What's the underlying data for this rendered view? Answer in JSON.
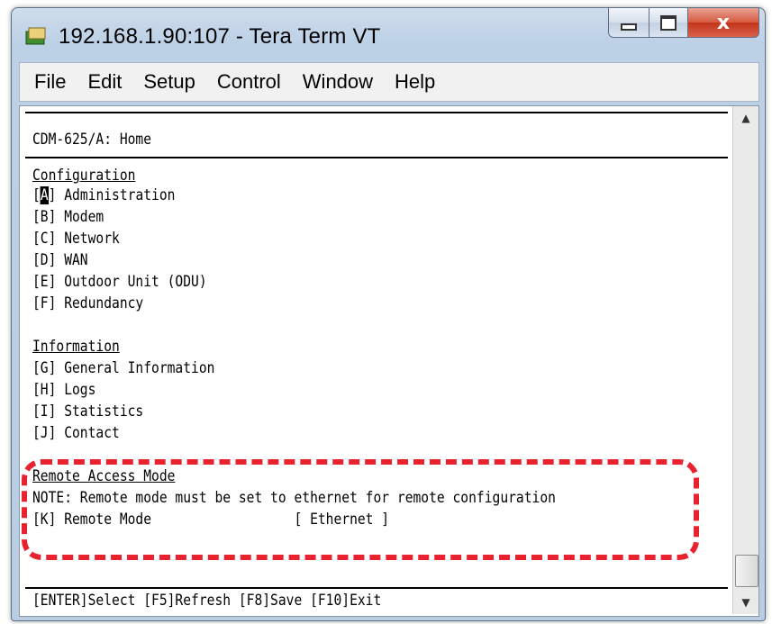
{
  "window": {
    "title": "192.168.1.90:107 - Tera Term VT",
    "icon": "tera-term-icon",
    "close_glyph": "x"
  },
  "menu": [
    "File",
    "Edit",
    "Setup",
    "Control",
    "Window",
    "Help"
  ],
  "terminal": {
    "header": "CDM-625/A: Home",
    "config_heading": "Configuration",
    "admin_key_open": "[",
    "admin_key_cursor": "A",
    "admin_key_rest": "] Administration",
    "config_items": [
      "[B] Modem",
      "[C] Network",
      "[D] WAN",
      "[E] Outdoor Unit (ODU)",
      "[F] Redundancy"
    ],
    "info_heading": "Information",
    "info_items": [
      "[G] General Information",
      "[H] Logs",
      "[I] Statistics",
      "[J] Contact"
    ],
    "remote_heading": "Remote Access Mode",
    "remote_note": "NOTE: Remote mode must be set to ethernet for remote configuration",
    "remote_item": "[K] Remote Mode                  [ Ethernet ]",
    "footer": "[ENTER]Select [F5]Refresh [F8]Save [F10]Exit"
  },
  "colors": {
    "highlight": "#e8232f",
    "frame": "#bcd0e6"
  }
}
